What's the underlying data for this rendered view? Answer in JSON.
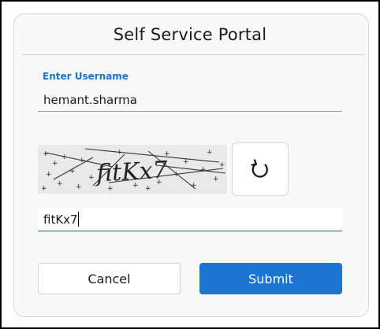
{
  "form": {
    "title": "Self Service Portal",
    "username_label": "Enter Username",
    "username_value": "hemant.sharma",
    "captcha_text": "fitKx7",
    "captcha_input_value": "fitKx7",
    "cancel_label": "Cancel",
    "submit_label": "Submit"
  },
  "icons": {
    "refresh": "refresh-icon"
  },
  "colors": {
    "label_blue": "#1a73c9",
    "submit_blue": "#1a74d2"
  }
}
